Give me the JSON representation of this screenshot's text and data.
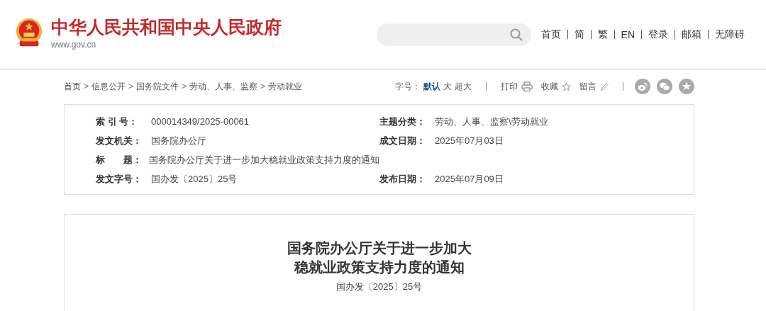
{
  "header": {
    "site_title": "中华人民共和国中央人民政府",
    "site_url": "www.gov.cn",
    "nav": [
      "首页",
      "简",
      "繁",
      "EN",
      "登录",
      "邮箱",
      "无障碍"
    ]
  },
  "breadcrumb": {
    "separator": ">",
    "items": [
      "首页",
      "信息公开",
      "国务院文件",
      "劳动、人事、监察",
      "劳动就业"
    ]
  },
  "tools": {
    "font_size_label": "字号：",
    "font_sizes": [
      {
        "label": "默认",
        "selected": true
      },
      {
        "label": "大",
        "selected": false
      },
      {
        "label": "超大",
        "selected": false
      }
    ],
    "print": "打印",
    "favorite": "收藏",
    "comment": "留言"
  },
  "meta": [
    [
      {
        "label": "索 引 号：",
        "value": "000014349/2025-00061"
      },
      {
        "label": "主题分类：",
        "value": "劳动、人事、监察\\劳动就业"
      }
    ],
    [
      {
        "label": "发文机关：",
        "value": "国务院办公厅"
      },
      {
        "label": "成文日期：",
        "value": "2025年07月03日"
      }
    ],
    [
      {
        "label": "标　　题：",
        "value": "国务院办公厅关于进一步加大稳就业政策支持力度的通知"
      }
    ],
    [
      {
        "label": "发文字号：",
        "value": "国办发〔2025〕25号"
      },
      {
        "label": "发布日期：",
        "value": "2025年07月09日"
      }
    ]
  ],
  "article": {
    "title_lines": [
      "国务院办公厅关于进一步加大",
      "稳就业政策支持力度的通知"
    ],
    "doc_number": "国办发〔2025〕25号"
  }
}
